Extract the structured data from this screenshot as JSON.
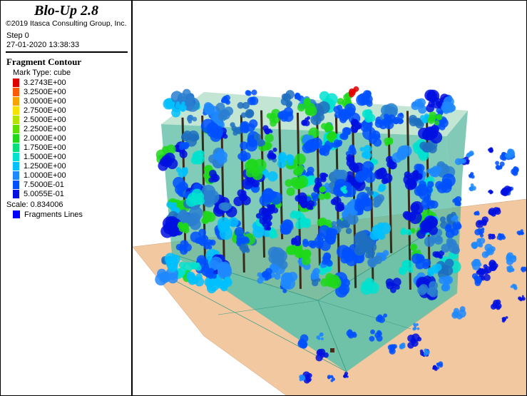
{
  "app": {
    "title": "Blo-Up 2.8",
    "copyright": "©2019 Itasca Consulting Group, Inc."
  },
  "status": {
    "step": "Step 0",
    "timestamp": "27-01-2020 13:38:33"
  },
  "legend": {
    "title": "Fragment Contour",
    "mark_type": "Mark Type: cube",
    "items": [
      {
        "label": "3.2743E+00",
        "color": "#e00000"
      },
      {
        "label": "3.2500E+00",
        "color": "#ff5a00"
      },
      {
        "label": "3.0000E+00",
        "color": "#f7a400"
      },
      {
        "label": "2.7500E+00",
        "color": "#f5e200"
      },
      {
        "label": "2.5000E+00",
        "color": "#b5e300"
      },
      {
        "label": "2.2500E+00",
        "color": "#5fdf00"
      },
      {
        "label": "2.0000E+00",
        "color": "#1fd81a"
      },
      {
        "label": "1.7500E+00",
        "color": "#00e07a"
      },
      {
        "label": "1.5000E+00",
        "color": "#00e2d0"
      },
      {
        "label": "1.2500E+00",
        "color": "#00c0ff"
      },
      {
        "label": "1.0000E+00",
        "color": "#1e88ff"
      },
      {
        "label": "7.5000E-01",
        "color": "#0050ff"
      },
      {
        "label": "5.0055E-01",
        "color": "#0010e0"
      }
    ],
    "scale": "Scale: 0.834006",
    "fragments_lines": {
      "label": "Fragments Lines",
      "color": "#0000ff"
    }
  }
}
